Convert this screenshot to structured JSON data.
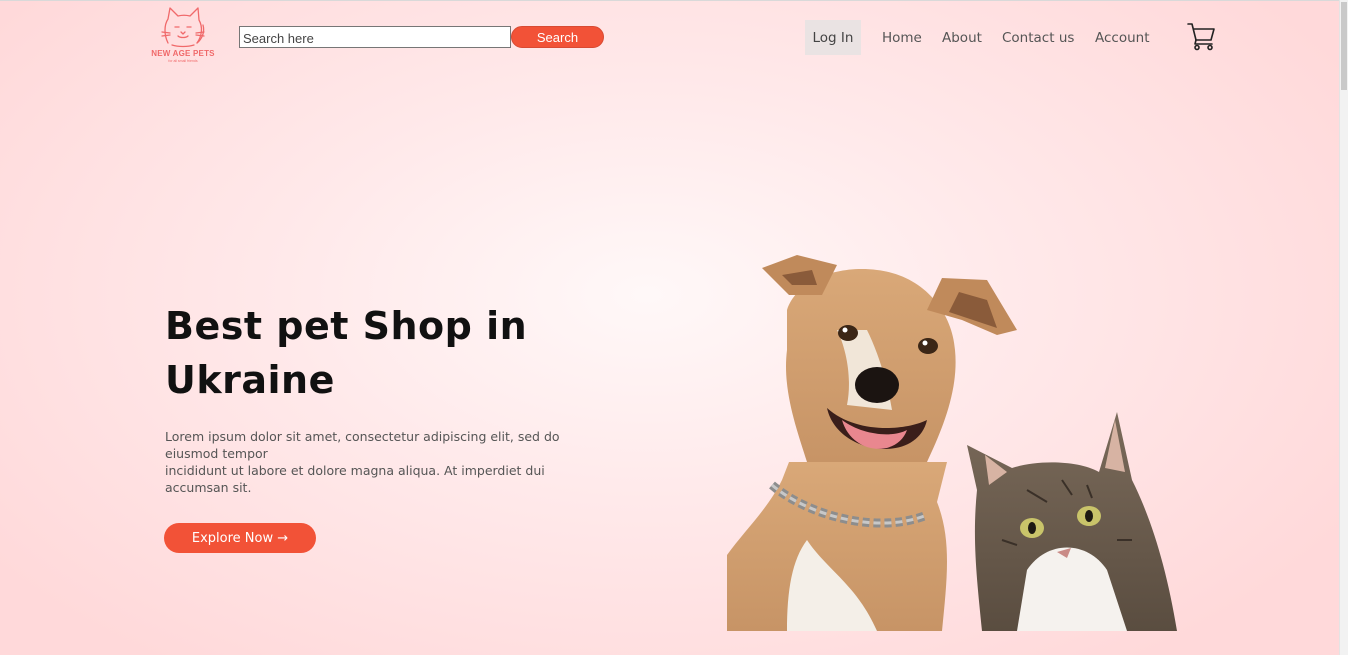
{
  "brand": {
    "name": "NEW AGE PETS",
    "tagline": "for all small friends",
    "color": "#f0696a"
  },
  "search": {
    "placeholder": "Search here",
    "value": "",
    "button_label": "Search"
  },
  "nav": {
    "login": "Log In",
    "home": "Home",
    "about": "About",
    "contact": "Contact us",
    "account": "Account",
    "cart_icon": "shopping-cart-icon"
  },
  "hero": {
    "title": "Best pet Shop in Ukraine",
    "text_line1": "Lorem ipsum dolor sit amet, consectetur adipiscing elit, sed do eiusmod tempor",
    "text_line2": "incididunt ut labore et dolore magna aliqua. At imperdiet dui accumsan sit.",
    "cta_label": "Explore Now →"
  },
  "colors": {
    "accent": "#f25237",
    "background": "#ffe4e4",
    "heading": "#111111",
    "body_text": "#555555"
  }
}
